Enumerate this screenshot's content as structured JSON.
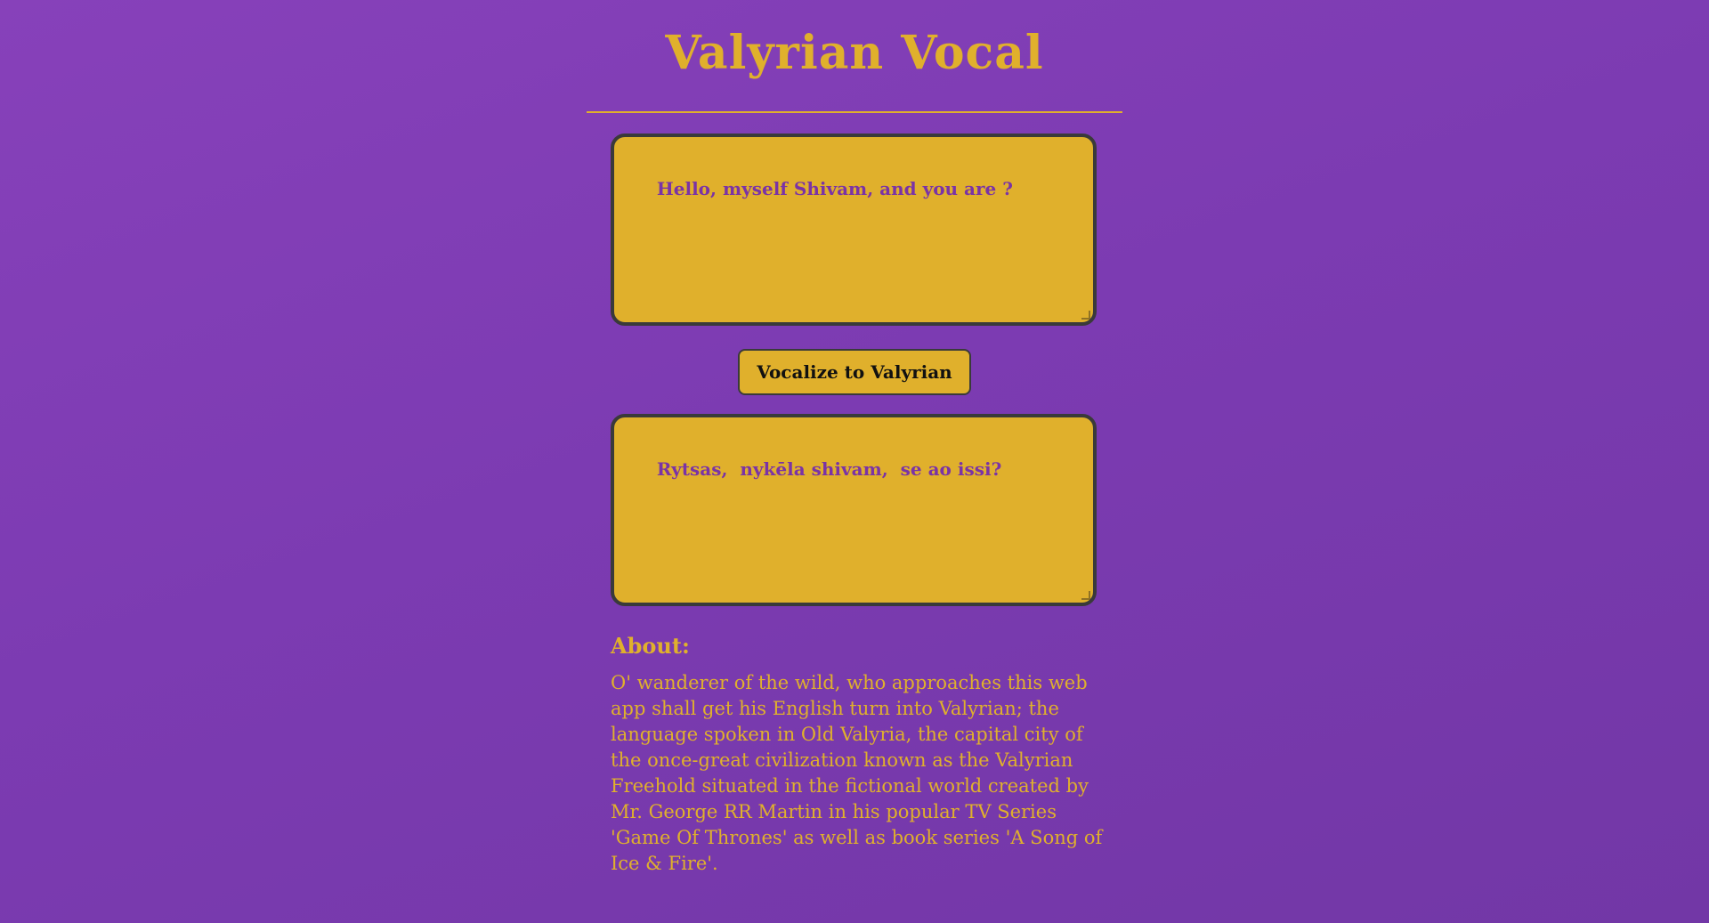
{
  "app": {
    "title": "Valyrian Vocal"
  },
  "input": {
    "value": "Hello, myself Shivam, and you are ?"
  },
  "translate_button": {
    "label": "Vocalize to Valyrian"
  },
  "output": {
    "value": "Rytsas,  nykēla shivam,  se ao issi?"
  },
  "about": {
    "heading": "About:",
    "text": "O' wanderer of the wild, who approaches this web app shall get his English turn into Valyrian; the language spoken in Old Valyria, the capital city of the once-great civilization known as the Valyrian Freehold situated in the fictional world created by Mr. George RR Martin in his popular TV Series 'Game Of Thrones' as well as book series 'A Song of Ice & Fire'."
  },
  "colors": {
    "background": "#8040b5",
    "accent_gold": "#e0b02c",
    "text_purple": "#7a33a6",
    "border_dark": "#3a3a3a"
  }
}
